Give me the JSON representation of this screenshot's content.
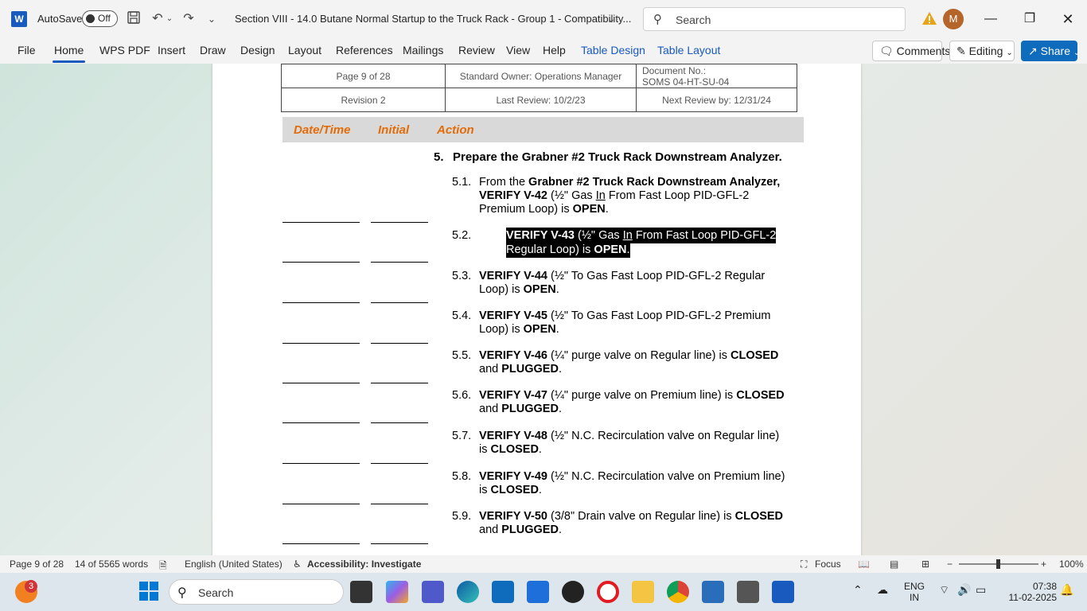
{
  "titlebar": {
    "app_icon": "W",
    "autosave_label": "AutoSave",
    "autosave_state": "Off",
    "doc_title": "Section VIII - 14.0 Butane Normal Startup to the Truck Rack - Group 1  -  Compatibility...",
    "search_placeholder": "Search",
    "avatar_initial": "M"
  },
  "ribbon": {
    "tabs": [
      "File",
      "Home",
      "WPS PDF",
      "Insert",
      "Draw",
      "Design",
      "Layout",
      "References",
      "Mailings",
      "Review",
      "View",
      "Help",
      "Table Design",
      "Table Layout"
    ],
    "comments_label": "Comments",
    "editing_label": "Editing",
    "share_label": "Share"
  },
  "doc_header": {
    "page": "Page 9 of 28",
    "owner": "Standard Owner: Operations Manager",
    "docno_label": "Document No.:",
    "docno": "SOMS 04-HT-SU-04",
    "revision": "Revision 2",
    "last_review": "Last Review: 10/2/23",
    "next_review": "Next Review by: 12/31/24"
  },
  "action_bar": {
    "date": "Date/Time",
    "initial": "Initial",
    "action": "Action"
  },
  "step": {
    "num": "5.",
    "title": "Prepare the Grabner #2 Truck Rack Downstream Analyzer."
  },
  "substeps": [
    {
      "num": "5.1.",
      "p1": "From the ",
      "b1": "Grabner #2 Truck Rack Downstream Analyzer,",
      "b2": "VERIFY V-42",
      "t2": " (½\" Gas ",
      "u": "In",
      "t3": " From Fast Loop PID-GFL-2 Premium Loop) is ",
      "b3": "OPEN",
      "t4": "."
    },
    {
      "num": "5.2.",
      "b1": "VERIFY V-43",
      "t1": " (½\" Gas ",
      "u": "In",
      "t2": " From Fast Loop PID-GFL-2 Regular Loop) is ",
      "b2": "OPEN",
      "t3": "."
    },
    {
      "num": "5.3.",
      "b1": "VERIFY V-44",
      "t1": " (½\" To Gas Fast Loop PID-GFL-2 Regular Loop) is ",
      "b2": "OPEN",
      "t2": "."
    },
    {
      "num": "5.4.",
      "b1": "VERIFY V-45",
      "t1": " (½\" To Gas Fast Loop PID-GFL-2 Premium Loop) is ",
      "b2": "OPEN",
      "t2": "."
    },
    {
      "num": "5.5.",
      "b1": "VERIFY V-46",
      "t1": " (¼\" purge valve on Regular line) is ",
      "b2": "CLOSED",
      "t2": " and ",
      "b3": "PLUGGED",
      "t3": "."
    },
    {
      "num": "5.6.",
      "b1": "VERIFY V-47",
      "t1": " (¼\" purge valve on Premium line) is ",
      "b2": "CLOSED",
      "t2": " and ",
      "b3": "PLUGGED",
      "t3": "."
    },
    {
      "num": "5.7.",
      "b1": "VERIFY V-48",
      "t1": " (½\" N.C. Recirculation valve on Regular line) is ",
      "b2": "CLOSED",
      "t2": "."
    },
    {
      "num": "5.8.",
      "b1": "VERIFY V-49",
      "t1": " (½\" N.C. Recirculation valve on Premium line) is ",
      "b2": "CLOSED",
      "t2": "."
    },
    {
      "num": "5.9.",
      "b1": "VERIFY V-50",
      "t1": " (3/8\" Drain valve on Regular line) is ",
      "b2": "CLOSED",
      "t2": " and ",
      "b3": "PLUGGED",
      "t3": "."
    }
  ],
  "statusbar": {
    "page": "Page 9 of 28",
    "words": "14 of 5565 words",
    "language": "English (United States)",
    "accessibility": "Accessibility: Investigate",
    "focus": "Focus",
    "zoom": "100%"
  },
  "taskbar": {
    "search_placeholder": "Search",
    "notification_count": "3",
    "lang_line1": "ENG",
    "lang_line2": "IN",
    "time": "07:38",
    "date": "11-02-2025"
  },
  "colors": {
    "accent": "#185abd",
    "action_header": "#e36c09",
    "share": "#0f6cbd"
  }
}
